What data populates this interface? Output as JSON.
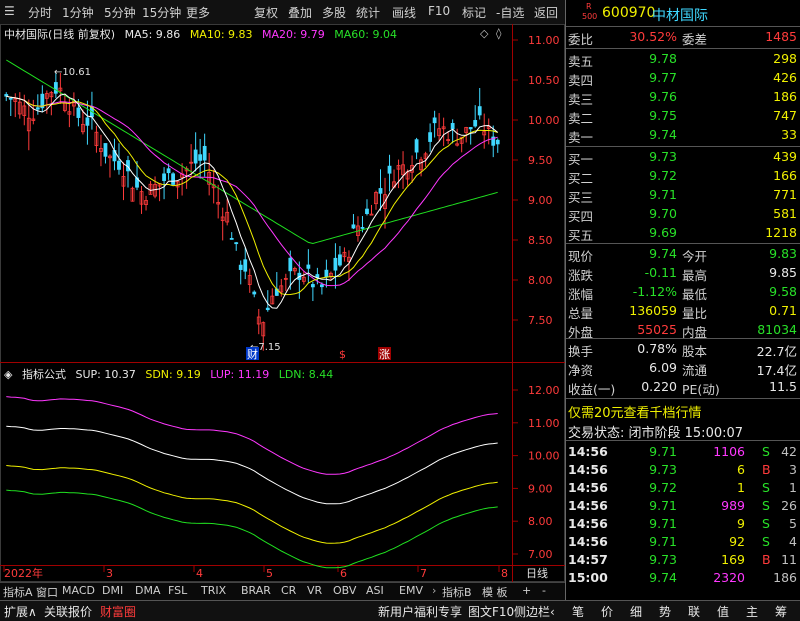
{
  "toolbar": {
    "left_items": [
      "分时",
      "1分钟",
      "5分钟",
      "15分钟",
      "更多"
    ],
    "right_items": [
      "复权",
      "叠加",
      "多股",
      "统计",
      "画线",
      "F10",
      "标记",
      "-自选",
      "返回"
    ]
  },
  "chart": {
    "title": "中材国际(日线 前复权)",
    "ma5": "MA5: 9.86",
    "ma10": "MA10: 9.83",
    "ma20": "MA20: 9.79",
    "ma60": "MA60: 9.04",
    "high_label": "10.61",
    "low_label": "7.15",
    "event_labels": [
      "财",
      "$",
      "涨"
    ],
    "price_ticks": [
      "11.00",
      "10.50",
      "10.00",
      "9.50",
      "9.00",
      "8.50",
      "8.00",
      "7.50"
    ],
    "colors": {
      "ma5": "#ffffff",
      "ma10": "#f0f000",
      "ma20": "#ff38ff",
      "ma60": "#20e020",
      "up": "#ff3b3b",
      "down": "#40d8ff"
    }
  },
  "indicator": {
    "name": "指标公式",
    "sup": "SUP: 10.37",
    "sdn": "SDN: 9.19",
    "lup": "LUP: 11.19",
    "ldn": "LDN: 8.44",
    "ticks": [
      "12.00",
      "11.00",
      "10.00",
      "9.00",
      "8.00",
      "7.00"
    ]
  },
  "chart_data": {
    "type": "line",
    "x_labels": [
      "2022年",
      "3",
      "4",
      "5",
      "6",
      "7",
      "8"
    ],
    "period_label": "日线",
    "series": [
      {
        "name": "MA5",
        "values": [
          10.3,
          10.2,
          10.1,
          9.8,
          9.5,
          9.2,
          9.4,
          9.6,
          9.2,
          8.6,
          7.7,
          7.8,
          8.1,
          8.0,
          8.3,
          8.7,
          9.2,
          9.6,
          9.9,
          9.9,
          9.86
        ]
      },
      {
        "name": "MA60",
        "values": [
          10.7,
          10.5,
          10.3,
          10.1,
          9.9,
          9.6,
          9.3,
          9.0,
          8.8,
          8.7,
          8.6,
          8.5,
          8.5,
          8.5,
          8.6,
          8.6,
          8.7,
          8.7,
          8.8,
          8.9,
          9.04
        ]
      }
    ]
  },
  "tabs": [
    "指标A",
    "窗口",
    "MACD",
    "DMI",
    "DMA",
    "FSL",
    "TRIX",
    "BRAR",
    "CR",
    "VR",
    "OBV",
    "ASI",
    "EMV"
  ],
  "tabs_right": [
    "指标B",
    "模 板",
    "+",
    "-"
  ],
  "statusbar": {
    "left": [
      "扩展∧",
      "关联报价",
      "财富圈"
    ],
    "mid": [
      "新用户福利专享",
      "图文F10",
      "侧边栏‹"
    ],
    "right": [
      "笔",
      "价",
      "细",
      "势",
      "联",
      "值",
      "主",
      "筹"
    ]
  },
  "quote": {
    "code": "600970",
    "name": "中材国际",
    "badge_top": "R",
    "badge_bottom": "500",
    "weibi_label": "委比",
    "weibi": "30.52%",
    "weicha_label": "委差",
    "weicha": "1485",
    "asks": [
      {
        "label": "卖五",
        "price": "9.78",
        "vol": "298"
      },
      {
        "label": "卖四",
        "price": "9.77",
        "vol": "426"
      },
      {
        "label": "卖三",
        "price": "9.76",
        "vol": "186"
      },
      {
        "label": "卖二",
        "price": "9.75",
        "vol": "747"
      },
      {
        "label": "卖一",
        "price": "9.74",
        "vol": "33"
      }
    ],
    "bids": [
      {
        "label": "买一",
        "price": "9.73",
        "vol": "439"
      },
      {
        "label": "买二",
        "price": "9.72",
        "vol": "166"
      },
      {
        "label": "买三",
        "price": "9.71",
        "vol": "771"
      },
      {
        "label": "买四",
        "price": "9.70",
        "vol": "581"
      },
      {
        "label": "买五",
        "price": "9.69",
        "vol": "1218"
      }
    ],
    "stats": [
      {
        "l1": "现价",
        "v1": "9.74",
        "l2": "今开",
        "v2": "9.83"
      },
      {
        "l1": "涨跌",
        "v1": "-0.11",
        "l2": "最高",
        "v2": "9.85"
      },
      {
        "l1": "涨幅",
        "v1": "-1.12%",
        "l2": "最低",
        "v2": "9.58"
      },
      {
        "l1": "总量",
        "v1": "136059",
        "l2": "量比",
        "v2": "0.71"
      },
      {
        "l1": "外盘",
        "v1": "55025",
        "l2": "内盘",
        "v2": "81034"
      }
    ],
    "stats2": [
      {
        "l1": "换手",
        "v1": "0.78%",
        "l2": "股本",
        "v2": "22.7亿"
      },
      {
        "l1": "净资",
        "v1": "6.09",
        "l2": "流通",
        "v2": "17.4亿"
      },
      {
        "l1": "收益(一)",
        "v1": "0.220",
        "l2": "PE(动)",
        "v2": "11.5"
      }
    ],
    "promo": "仅需20元查看千档行情",
    "trade_status": "交易状态: 闭市阶段 15:00:07",
    "ticks": [
      {
        "time": "14:56",
        "price": "9.71",
        "vol": "1106",
        "bs": "S",
        "n": "42"
      },
      {
        "time": "14:56",
        "price": "9.73",
        "vol": "6",
        "bs": "B",
        "n": "3"
      },
      {
        "time": "14:56",
        "price": "9.72",
        "vol": "1",
        "bs": "S",
        "n": "1"
      },
      {
        "time": "14:56",
        "price": "9.71",
        "vol": "989",
        "bs": "S",
        "n": "26"
      },
      {
        "time": "14:56",
        "price": "9.71",
        "vol": "9",
        "bs": "S",
        "n": "5"
      },
      {
        "time": "14:56",
        "price": "9.71",
        "vol": "92",
        "bs": "S",
        "n": "4"
      },
      {
        "time": "14:57",
        "price": "9.73",
        "vol": "169",
        "bs": "B",
        "n": "11"
      },
      {
        "time": "15:00",
        "price": "9.74",
        "vol": "2320",
        "bs": "",
        "n": "186"
      }
    ]
  }
}
